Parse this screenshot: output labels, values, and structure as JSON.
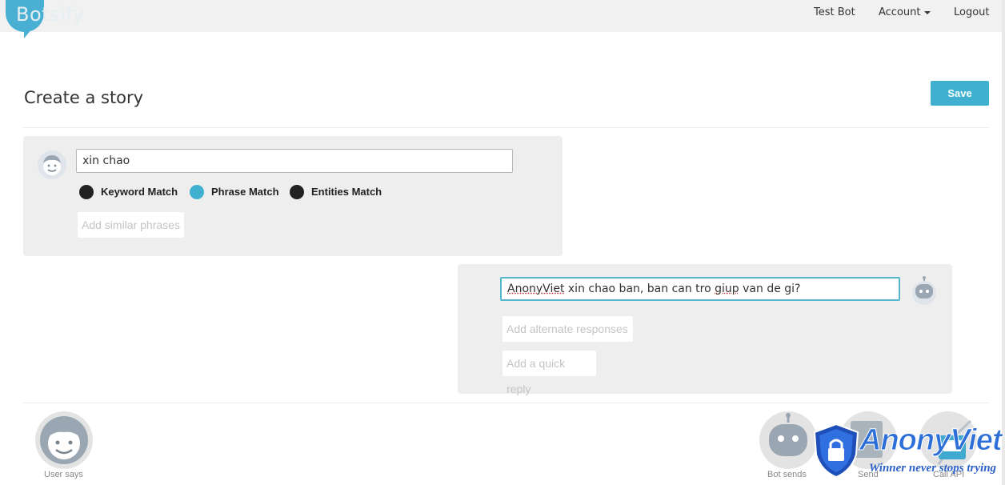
{
  "brand": {
    "logo_text": "Botsify",
    "accent": "#4ab0d3"
  },
  "nav": {
    "bot_name": "Test Bot",
    "account_label": "Account",
    "logout_label": "Logout"
  },
  "page": {
    "title": "Create a story",
    "save_label": "Save"
  },
  "user_block": {
    "input_value": "xin chao",
    "match_options": [
      {
        "label": "Keyword Match",
        "selected": false
      },
      {
        "label": "Phrase Match",
        "selected": true
      },
      {
        "label": "Entities Match",
        "selected": false
      }
    ],
    "add_similar_label": "Add similar phrases"
  },
  "bot_block": {
    "response_prefix": "AnonyViet",
    "response_middle": " xin chao ban, ban can tro ",
    "response_word": "giup",
    "response_suffix": " van de gi?",
    "add_alternate_label": "Add alternate responses",
    "add_quick_reply_label": "Add a quick reply"
  },
  "toolbar": {
    "user_says_label": "User says",
    "bot_sends_label": "Bot sends",
    "send_label": "Send",
    "call_api_label": "Call API"
  },
  "watermark": {
    "brand": "AnonyViet",
    "tagline": "Winner never stops trying"
  }
}
